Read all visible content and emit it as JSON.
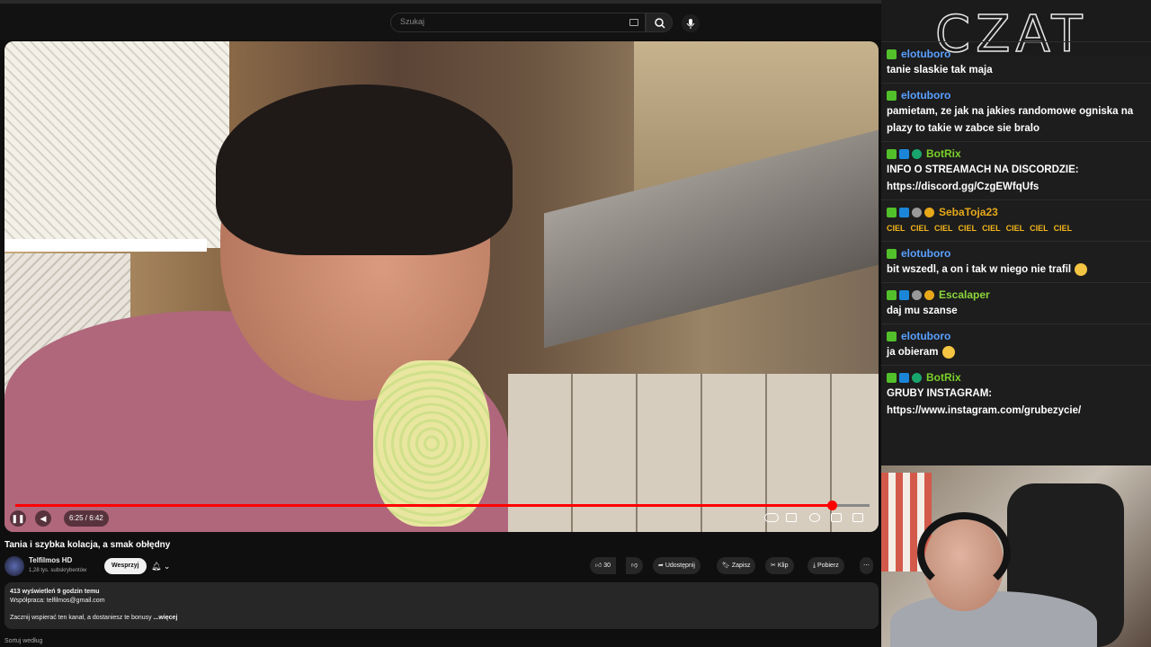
{
  "search": {
    "placeholder": "Szukaj"
  },
  "player": {
    "time": "6:25 / 6:42",
    "progress_fraction": 0.956
  },
  "video": {
    "title": "Tania i szybka kolacja, a smak obłędny"
  },
  "channel": {
    "name": "Telfilmos HD",
    "subscribers": "1,28 tys. subskrybentów",
    "support_label": "Wesprzyj"
  },
  "actions": {
    "likes": "30",
    "share": "Udostępnij",
    "save": "Zapisz",
    "clip": "Klip",
    "download": "Pobierz"
  },
  "description": {
    "meta": "413 wyświetleń  9 godzin temu",
    "line1": "Współpraca: telfilmos@gmail.com",
    "line2": "Zacznij wspierać ten kanał, a dostaniesz te bonusy",
    "more": "...więcej"
  },
  "bottom": {
    "sort": "Sortuj według"
  },
  "chat": {
    "title": "CZAT",
    "messages": [
      {
        "user": "elotuboro",
        "color": "#5aa0ff",
        "text": "tanie slaskie tak maja"
      },
      {
        "user": "elotuboro",
        "color": "#5aa0ff",
        "text": "pamietam, ze jak na jakies randomowe ogniska na plazy to takie w zabce sie bralo"
      },
      {
        "user": "BotRix",
        "color": "#7ad12a",
        "text": "INFO O STREAMACH NA DISCORDZIE: https://discord.gg/CzgEWfqUfs"
      },
      {
        "user": "SebaToja23",
        "color": "#e7a81a",
        "emotes": [
          "CIEL",
          "CIEL",
          "CIEL",
          "CIEL",
          "CIEL",
          "CIEL",
          "CIEL",
          "CIEL"
        ]
      },
      {
        "user": "elotuboro",
        "color": "#5aa0ff",
        "text": "bit wszedl, a on i tak w niego nie trafil"
      },
      {
        "user": "Escalaper",
        "color": "#8bd63c",
        "text": "daj mu szanse"
      },
      {
        "user": "elotuboro",
        "color": "#5aa0ff",
        "text": "ja obieram"
      },
      {
        "user": "BotRix",
        "color": "#7ad12a",
        "text": "GRUBY INSTAGRAM: https://www.instagram.com/grubezycie/"
      }
    ]
  },
  "icons": {
    "pause": "pause-icon",
    "volume": "volume-icon",
    "like": "thumbs-up-icon",
    "dislike": "thumbs-down-icon",
    "share": "share-icon",
    "save": "bookmark-icon",
    "clip": "scissors-icon",
    "download": "download-icon",
    "more": "more-icon",
    "search": "search-icon",
    "mic": "mic-icon",
    "bell": "bell-icon"
  }
}
